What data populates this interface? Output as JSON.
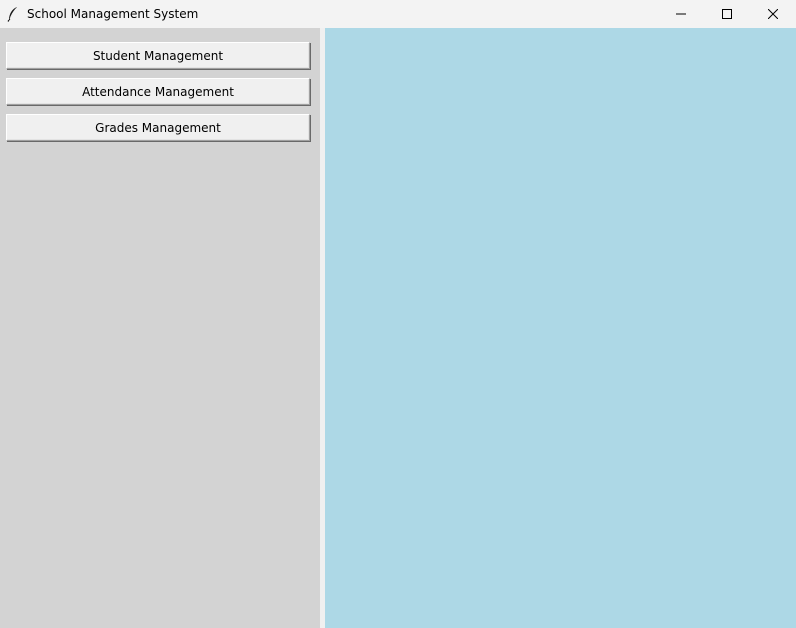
{
  "window": {
    "title": "School Management System",
    "icon": "feather-icon",
    "controls": [
      "minimize-icon",
      "maximize-icon",
      "close-icon"
    ]
  },
  "sidebar": {
    "background": "#d3d3d3",
    "buttons": [
      {
        "label": "Student Management"
      },
      {
        "label": "Attendance Management"
      },
      {
        "label": "Grades Management"
      }
    ]
  },
  "content": {
    "background": "#add8e6"
  }
}
